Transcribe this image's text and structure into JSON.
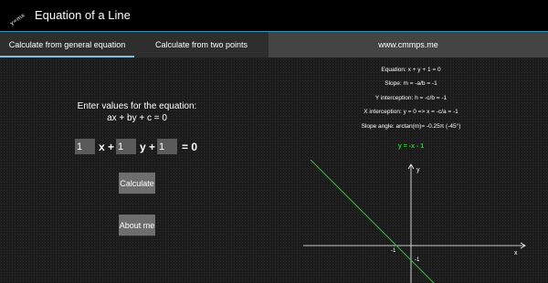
{
  "app": {
    "icon_text": "y=mx+h",
    "title": "Equation of a Line"
  },
  "tabs": [
    {
      "label": "Calculate from general equation",
      "selected": true
    },
    {
      "label": "Calculate from two points",
      "selected": false
    },
    {
      "label": "www.cmmps.me",
      "selected": false
    }
  ],
  "form": {
    "prompt_line1": "Enter values for the equation:",
    "prompt_line2": "ax + by + c = 0",
    "a_value": "1",
    "b_value": "1",
    "c_value": "1",
    "x_plus": "x +",
    "y_plus": "y +",
    "equals_zero": "= 0",
    "calculate_label": "Calculate",
    "about_label": "About me"
  },
  "results": {
    "equation": "Equation: x + y + 1 = 0",
    "slope": "Slope: m = -a/b = -1",
    "y_intercept": "Y interception: h = -c/b = -1",
    "x_intercept": "X interception: y = 0 => x = -c/a = -1",
    "slope_angle": "Slope angle: arctan(m)= -0.25π (-45°)",
    "line_equation": "y = -x - 1"
  },
  "graph": {
    "x_axis_label": "x",
    "y_axis_label": "y",
    "x_tick_label": "-1",
    "y_tick_label": "-1",
    "slope": -1,
    "intercept": -1,
    "line_color": "#2ecc2e"
  },
  "colors": {
    "accent": "#3a8fbf",
    "tab_indicator": "#7fbfe0",
    "button_bg": "#6e6e6e",
    "input_bg": "#5a5a5a"
  }
}
